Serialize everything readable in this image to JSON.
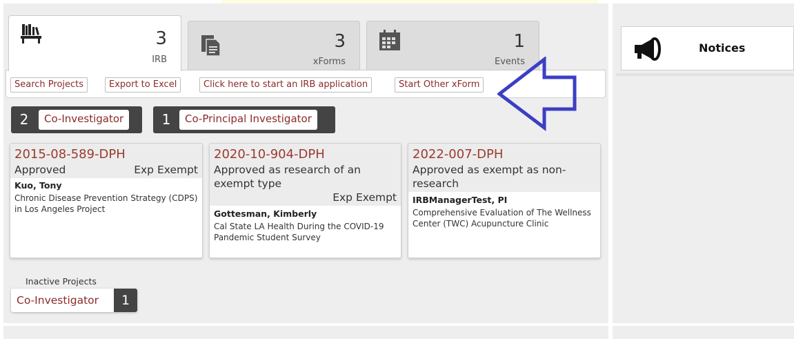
{
  "tabs": [
    {
      "count": "3",
      "label": "IRB",
      "icon": "books-icon"
    },
    {
      "count": "3",
      "label": "xForms",
      "icon": "documents-icon"
    },
    {
      "count": "1",
      "label": "Events",
      "icon": "calendar-icon"
    }
  ],
  "actions": {
    "search": "Search Projects",
    "export": "Export to Excel",
    "start_irb": "Click here to start an IRB application",
    "start_xform": "Start Other xForm"
  },
  "roles": [
    {
      "count": "2",
      "label": "Co-Investigator"
    },
    {
      "count": "1",
      "label": "Co-Principal Investigator"
    }
  ],
  "projects": [
    {
      "id": "2015-08-589-DPH",
      "status": "Approved",
      "type": "Exp Exempt",
      "pi": "Kuo, Tony",
      "title": "Chronic Disease Prevention Strategy (CDPS) in Los Angeles Project"
    },
    {
      "id": "2020-10-904-DPH",
      "status": "Approved as research of an exempt type",
      "type": "Exp Exempt",
      "pi": "Gottesman, Kimberly",
      "title": "Cal State LA Health During the COVID-19 Pandemic Student Survey"
    },
    {
      "id": "2022-007-DPH",
      "status": "Approved as exempt as non-research",
      "type": "",
      "pi": "IRBManagerTest, PI",
      "title": "Comprehensive Evaluation of The Wellness Center (TWC) Acupuncture Clinic"
    }
  ],
  "inactive": {
    "heading": "Inactive Projects",
    "label": "Co-Investigator",
    "count": "1"
  },
  "notices": {
    "title": "Notices",
    "icon": "megaphone-icon"
  },
  "colors": {
    "accent": "#8b2a2a",
    "project_id": "#9a3b2f",
    "arrow": "#3b3fc4",
    "dark_pill": "#444444"
  }
}
